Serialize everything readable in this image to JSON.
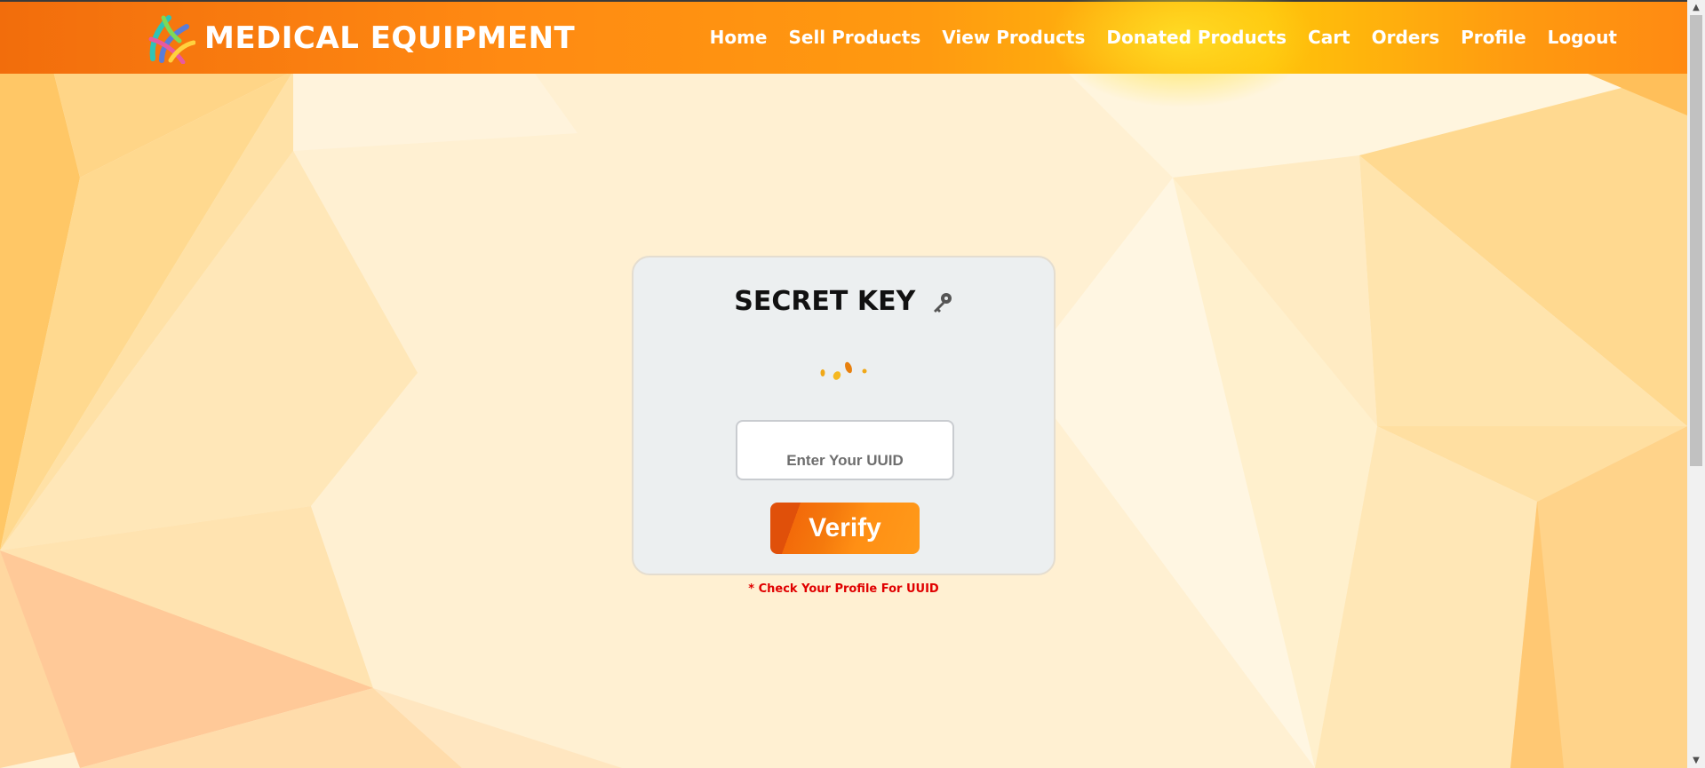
{
  "brand": {
    "title": "MEDICAL EQUIPMENT",
    "logo_icon": "medical-logo-icon"
  },
  "nav": {
    "links": [
      "Home",
      "Sell Products",
      "View Products",
      "Donated Products",
      "Cart",
      "Orders",
      "Profile",
      "Logout"
    ]
  },
  "card": {
    "title": "SECRET KEY",
    "title_icon": "key-icon",
    "input_placeholder": "Enter Your UUID",
    "input_value": "",
    "verify_label": "Verify"
  },
  "hint": "* Check Your Profile For UUID",
  "colors": {
    "nav_orange": "#ff8a12",
    "nav_yellow": "#ffc40a",
    "hint_red": "#e00000",
    "card_bg": "#eceff0"
  }
}
